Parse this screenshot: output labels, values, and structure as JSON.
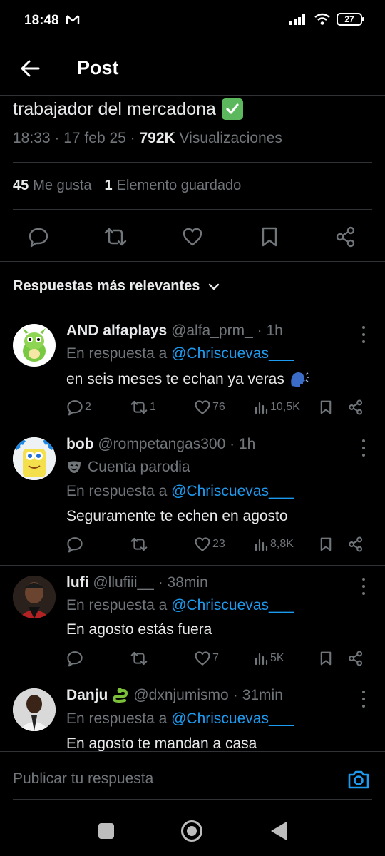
{
  "status": {
    "time": "18:48",
    "battery": "27"
  },
  "header": {
    "title": "Post"
  },
  "tweet": {
    "text": "trabajador del mercadona",
    "time": "18:33",
    "date": "17 feb 25",
    "views_count": "792K",
    "views_label": "Visualizaciones",
    "likes_count": "45",
    "likes_label": "Me gusta",
    "saved_count": "1",
    "saved_label": "Elemento guardado"
  },
  "sort": {
    "label": "Respuestas más relevantes"
  },
  "replies": [
    {
      "name": "AND alfaplays",
      "handle": "@alfa_prm_",
      "time": "1h",
      "reply_prefix": "En respuesta a",
      "reply_to": "@Chriscuevas___",
      "text": "en seis meses te echan ya veras",
      "replies": "2",
      "retweets": "1",
      "likes": "76",
      "views": "10,5K"
    },
    {
      "name": "bob",
      "handle": "@rompetangas300",
      "time": "1h",
      "badge": "Cuenta parodia",
      "reply_prefix": "En respuesta a",
      "reply_to": "@Chriscuevas___",
      "text": "Seguramente te echen en agosto",
      "replies": "",
      "retweets": "",
      "likes": "23",
      "views": "8,8K"
    },
    {
      "name": "lufi",
      "handle": "@llufiii__",
      "time": "38min",
      "reply_prefix": "En respuesta a",
      "reply_to": "@Chriscuevas___",
      "text": "En agosto estás fuera",
      "replies": "",
      "retweets": "",
      "likes": "7",
      "views": "5K"
    },
    {
      "name": "Danju",
      "handle": "@dxnjumismo",
      "time": "31min",
      "reply_prefix": "En respuesta a",
      "reply_to": "@Chriscuevas___",
      "text": "En agosto te mandan a casa"
    }
  ],
  "composer": {
    "placeholder": "Publicar tu respuesta"
  },
  "colors": {
    "background": "#000000",
    "accent": "#1d9bf0",
    "muted": "#71767b",
    "text": "#e7e9ea"
  }
}
